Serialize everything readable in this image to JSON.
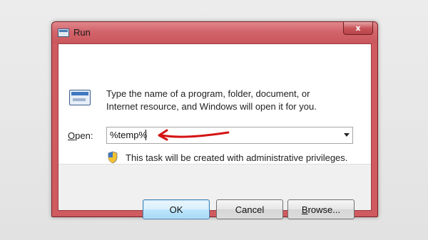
{
  "window": {
    "title": "Run",
    "close_glyph": "x",
    "accent_color": "#cf5a5f"
  },
  "dialog": {
    "description": "Type the name of a program, folder, document, or Internet resource, and Windows will open it for you.",
    "open_label_accel": "O",
    "open_label_rest": "pen:",
    "open_value": "%temp%",
    "admin_note": "This task will be created with administrative privileges."
  },
  "buttons": {
    "ok": "OK",
    "cancel": "Cancel",
    "browse_accel": "B",
    "browse_rest": "rowse..."
  },
  "icons": {
    "title": "run-icon",
    "program": "run-icon",
    "shield": "uac-shield-icon",
    "dropdown": "chevron-down-icon",
    "annotation": "red-arrow"
  },
  "annotation_color": "#d41414"
}
